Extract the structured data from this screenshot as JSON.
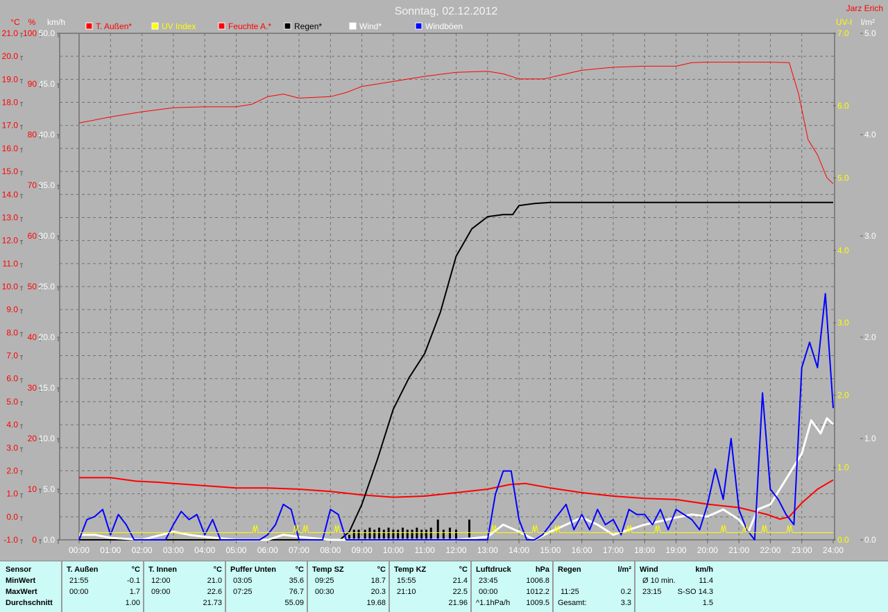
{
  "header": {
    "title": "Sonntag, 02.12.2012",
    "author": "Jarz Erich"
  },
  "chart_data": {
    "type": "line",
    "title": "Sonntag, 02.12.2012",
    "x_unit": "hours",
    "xlim": [
      0,
      24
    ],
    "x_tick_labels": [
      "00:00",
      "01:00",
      "02:00",
      "03:00",
      "04:00",
      "05:00",
      "06:00",
      "07:00",
      "08:00",
      "09:00",
      "10:00",
      "11:00",
      "12:00",
      "13:00",
      "14:00",
      "15:00",
      "16:00",
      "17:00",
      "18:00",
      "19:00",
      "20:00",
      "21:00",
      "22:00",
      "23:00",
      "24:00"
    ],
    "axes": {
      "temp": {
        "label": "°C",
        "range": [
          -1,
          21
        ],
        "step": 1,
        "color": "#ff0000"
      },
      "humidity": {
        "label": "%",
        "range": [
          0,
          100
        ],
        "step": 10,
        "color": "#ff0000"
      },
      "wind": {
        "label": "km/h",
        "range": [
          0,
          50
        ],
        "step": 5,
        "color": "#ffffff"
      },
      "uv": {
        "label": "UV-I",
        "range": [
          0,
          7
        ],
        "step": 1,
        "color": "#ffff00"
      },
      "rain": {
        "label": "l/m²",
        "range": [
          0,
          5
        ],
        "step": 1,
        "color": "#ffffff"
      }
    },
    "legend": [
      {
        "name": "T. Außen*",
        "color": "#ff0000",
        "label_color": "#ff0000"
      },
      {
        "name": "UV Index",
        "color": "#ffff00",
        "label_color": "#ffff00"
      },
      {
        "name": "Feuchte A.*",
        "color": "#ff0000",
        "label_color": "#ff0000"
      },
      {
        "name": "Regen*",
        "color": "#000000",
        "label_color": "#000000"
      },
      {
        "name": "Wind*",
        "color": "#ffffff",
        "label_color": "#ffffff"
      },
      {
        "name": "Windböen",
        "color": "#0000ff",
        "label_color": "#ffffff"
      }
    ],
    "series": [
      {
        "name": "Feuchte A.",
        "axis": "humidity",
        "color": "#ff0000",
        "width": 1,
        "x": [
          0,
          1,
          2,
          3,
          4,
          5,
          5.5,
          6,
          6.5,
          7,
          8,
          8.5,
          9,
          10,
          11,
          12,
          13,
          13.5,
          14,
          14.8,
          15.5,
          16,
          17,
          18,
          19,
          19.5,
          20,
          21,
          22,
          22.6,
          22.9,
          23.2,
          23.5,
          23.8,
          24
        ],
        "y": [
          82.3,
          83.5,
          84.5,
          85.3,
          85.5,
          85.5,
          86,
          87.5,
          88,
          87.2,
          87.5,
          88.3,
          89.5,
          90.5,
          91.5,
          92.3,
          92.5,
          92,
          91,
          91,
          92,
          92.7,
          93.3,
          93.5,
          93.5,
          94.2,
          94.3,
          94.3,
          94.3,
          94.2,
          88,
          79,
          76,
          71.5,
          70.3
        ]
      },
      {
        "name": "T. Außen",
        "axis": "temp",
        "color": "#ff0000",
        "width": 2,
        "x": [
          0,
          1,
          1.8,
          2.5,
          3,
          4,
          5,
          6,
          7,
          8,
          9,
          10,
          11,
          12,
          13,
          13.7,
          14.2,
          15,
          16,
          17,
          18,
          19,
          20,
          21,
          21.9,
          22.3,
          22.6,
          23,
          23.5,
          24
        ],
        "y": [
          1.7,
          1.7,
          1.55,
          1.5,
          1.45,
          1.35,
          1.25,
          1.25,
          1.2,
          1.1,
          0.95,
          0.85,
          0.9,
          1.05,
          1.2,
          1.4,
          1.45,
          1.25,
          1.05,
          0.9,
          0.8,
          0.75,
          0.55,
          0.4,
          0.1,
          -0.1,
          0.0,
          0.6,
          1.2,
          1.6
        ]
      },
      {
        "name": "Regen",
        "axis": "rain",
        "color": "#000000",
        "width": 2,
        "x": [
          0,
          8.3,
          8.6,
          9,
          9.5,
          10,
          10.5,
          11,
          11.5,
          12,
          12.5,
          13,
          13.5,
          13.8,
          14,
          14.5,
          15,
          24
        ],
        "y": [
          0,
          0,
          0.08,
          0.35,
          0.8,
          1.29,
          1.6,
          1.84,
          2.25,
          2.8,
          3.07,
          3.19,
          3.21,
          3.21,
          3.3,
          3.32,
          3.33,
          3.33
        ]
      },
      {
        "name": "Wind",
        "axis": "wind",
        "color": "#ffffff",
        "width": 3,
        "x": [
          0,
          0.5,
          1,
          2,
          3,
          3.5,
          4,
          5,
          6,
          6.5,
          7,
          8,
          9,
          12,
          13,
          13.5,
          14,
          14.5,
          15,
          15.5,
          16,
          16.5,
          17,
          17.5,
          18,
          19,
          19.5,
          20,
          20.5,
          21,
          21.3,
          21.6,
          22,
          22.5,
          23,
          23.3,
          23.6,
          23.8,
          24
        ],
        "y": [
          0.5,
          0.5,
          0.2,
          0,
          0.8,
          0.5,
          0.3,
          0,
          0,
          0.5,
          0.3,
          0,
          0,
          0,
          0.3,
          1.5,
          0.8,
          0,
          0.8,
          1.5,
          2.2,
          1.5,
          0.5,
          1,
          1.5,
          2.2,
          2.5,
          2.3,
          3,
          2,
          0.8,
          3,
          3.5,
          6,
          8.5,
          11.8,
          10.5,
          12,
          11.4
        ]
      },
      {
        "name": "Windböen",
        "axis": "wind",
        "color": "#0000ff",
        "width": 2,
        "x_step": 0.25,
        "y": [
          0,
          2,
          2.3,
          3,
          0.5,
          2.5,
          1.5,
          0,
          0,
          0,
          0,
          0,
          1.5,
          2.8,
          2,
          2.5,
          0.5,
          2,
          0,
          0,
          0,
          0,
          0,
          0,
          0.5,
          1.5,
          3.5,
          3,
          0,
          0,
          0,
          0,
          3,
          2.5,
          0,
          0,
          0,
          0,
          0,
          0,
          0,
          0,
          0,
          0,
          0,
          0,
          0,
          0,
          0,
          0,
          0,
          0,
          0,
          4.5,
          6.8,
          6.8,
          2,
          0,
          0,
          0.5,
          1.5,
          2.5,
          3.5,
          1,
          2.5,
          1,
          3,
          1.5,
          2,
          0.5,
          3,
          2.5,
          2.5,
          1.5,
          3,
          1,
          3,
          2.5,
          2,
          1,
          3.5,
          7,
          4,
          10,
          3,
          1,
          0,
          14.5,
          5,
          4,
          2.5,
          1.5,
          17,
          19.5,
          17,
          24.3,
          13
        ]
      },
      {
        "name": "UV Index",
        "axis": "uv",
        "color": "#ffff00",
        "width": 1,
        "base": 0.1,
        "bump_value": 0.2,
        "bumps": [
          5.6,
          6.9,
          7.2,
          8.2,
          13.2,
          14.5,
          15.2,
          17.5,
          18.4,
          20.5,
          21.2,
          21.8,
          22.6
        ]
      }
    ],
    "rain_bars": {
      "axis": "rain",
      "color": "#000000",
      "x": [
        8.6,
        8.75,
        8.9,
        9.1,
        9.25,
        9.4,
        9.55,
        9.7,
        9.85,
        10.0,
        10.15,
        10.3,
        10.45,
        10.6,
        10.75,
        10.9,
        11.05,
        11.2,
        11.42,
        11.6,
        11.8,
        12.0,
        12.42
      ],
      "y": [
        0.05,
        0.1,
        0.1,
        0.1,
        0.12,
        0.1,
        0.12,
        0.1,
        0.12,
        0.1,
        0.1,
        0.12,
        0.1,
        0.1,
        0.12,
        0.1,
        0.1,
        0.12,
        0.2,
        0.1,
        0.12,
        0.1,
        0.2
      ]
    }
  },
  "table": {
    "sensor": {
      "title": "Sensor",
      "rows": [
        "MinWert",
        "MaxWert",
        "Durchschnitt"
      ]
    },
    "columns": [
      {
        "title": "T. Außen",
        "unit": "°C",
        "min_time": "21:55",
        "min": "-0.1",
        "max_time": "00:00",
        "max": "1.7",
        "avg_label": "",
        "avg": "1.00"
      },
      {
        "title": "T. Innen",
        "unit": "°C",
        "min_time": "12:00",
        "min": "21.0",
        "max_time": "09:00",
        "max": "22.6",
        "avg_label": "",
        "avg": "21.73"
      },
      {
        "title": "Puffer Unten",
        "unit": "°C",
        "min_time": "03:05",
        "min": "35.6",
        "max_time": "07:25",
        "max": "76.7",
        "avg_label": "",
        "avg": "55.09"
      },
      {
        "title": "Temp SZ",
        "unit": "°C",
        "min_time": "09:25",
        "min": "18.7",
        "max_time": "00:30",
        "max": "20.3",
        "avg_label": "",
        "avg": "19.68"
      },
      {
        "title": "Temp KZ",
        "unit": "°C",
        "min_time": "15:55",
        "min": "21.4",
        "max_time": "21:10",
        "max": "22.5",
        "avg_label": "",
        "avg": "21.96"
      },
      {
        "title": "Luftdruck",
        "unit": "hPa",
        "min_time": "23:45",
        "min": "1006.8",
        "max_time": "00:00",
        "max": "1012.2",
        "avg_label": "^1.1hPa/h",
        "avg": "1009.5"
      },
      {
        "title": "Regen",
        "unit": "l/m²",
        "min_time": "",
        "min": "",
        "max_time": "11:25",
        "max": "0.2",
        "avg_label": "Gesamt:",
        "avg": "3.3"
      },
      {
        "title": "Wind",
        "unit": "km/h",
        "min_time": "Ø 10 min.",
        "min": "11.4",
        "max_time": "23:15",
        "max": "S-SO 14.3",
        "avg_label": "",
        "avg": "1.5"
      }
    ]
  }
}
